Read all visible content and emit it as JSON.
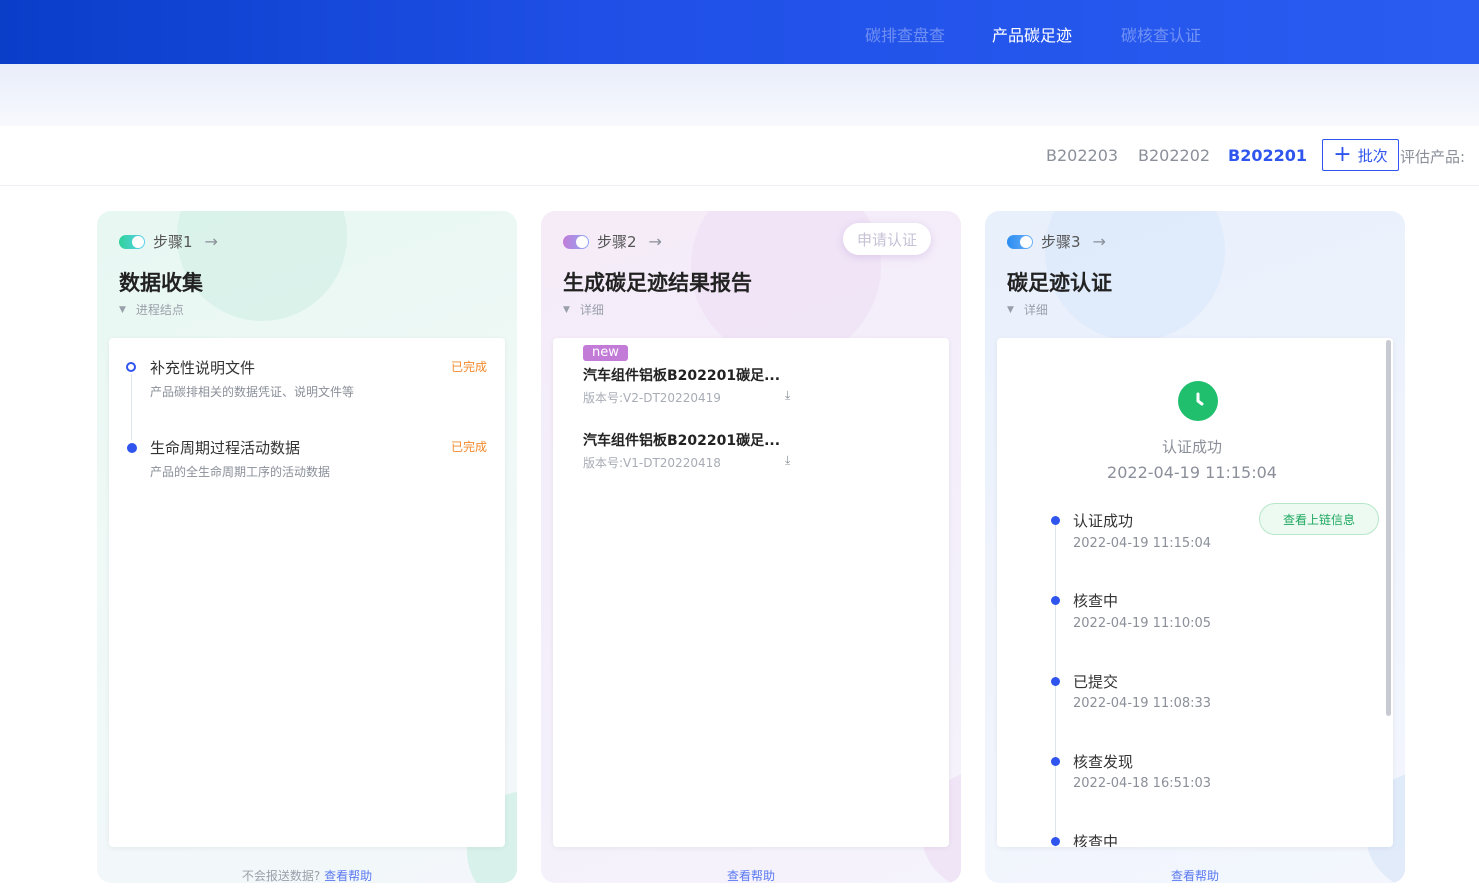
{
  "nav": {
    "items": [
      {
        "label": "碳排查盘查"
      },
      {
        "label": "产品碳足迹"
      },
      {
        "label": "碳核查认证"
      }
    ]
  },
  "batches": {
    "tabs": [
      "B202203",
      "B202202",
      "B202201"
    ],
    "active": "B202201",
    "add_label": "批次",
    "eval_label": "评估产品:"
  },
  "colors": {
    "accent": "#2f55ee",
    "success": "#1fbf6e",
    "warning": "#f28a2b",
    "badge": "#c27cd8"
  },
  "steps": [
    {
      "step_label": "步骤1",
      "title": "数据收集",
      "sub": "进程结点",
      "footer_text": "不会报送数据?",
      "footer_link": "查看帮助",
      "items": [
        {
          "title": "补充性说明文件",
          "desc": "产品碳排相关的数据凭证、说明文件等",
          "status": "已完成"
        },
        {
          "title": "生命周期过程活动数据",
          "desc": "产品的全生命周期工序的活动数据",
          "status": "已完成"
        }
      ]
    },
    {
      "step_label": "步骤2",
      "title": "生成碳足迹结果报告",
      "sub": "详细",
      "apply_label": "申请认证",
      "footer_link": "查看帮助",
      "files": [
        {
          "badge": "new",
          "name": "汽车组件铝板B202201碳足...",
          "version": "版本号:V2-DT20220419"
        },
        {
          "name": "汽车组件铝板B202201碳足...",
          "version": "版本号:V1-DT20220418"
        }
      ]
    },
    {
      "step_label": "步骤3",
      "title": "碳足迹认证",
      "sub": "详细",
      "footer_link": "查看帮助",
      "result_text": "认证成功",
      "result_time": "2022-04-19 11:15:04",
      "chain_button": "查看上链信息",
      "timeline": [
        {
          "title": "认证成功",
          "time": "2022-04-19 11:15:04"
        },
        {
          "title": "核查中",
          "time": "2022-04-19 11:10:05"
        },
        {
          "title": "已提交",
          "time": "2022-04-19 11:08:33"
        },
        {
          "title": "核查发现",
          "time": "2022-04-18 16:51:03"
        },
        {
          "title": "核查中",
          "time": ""
        }
      ]
    }
  ]
}
